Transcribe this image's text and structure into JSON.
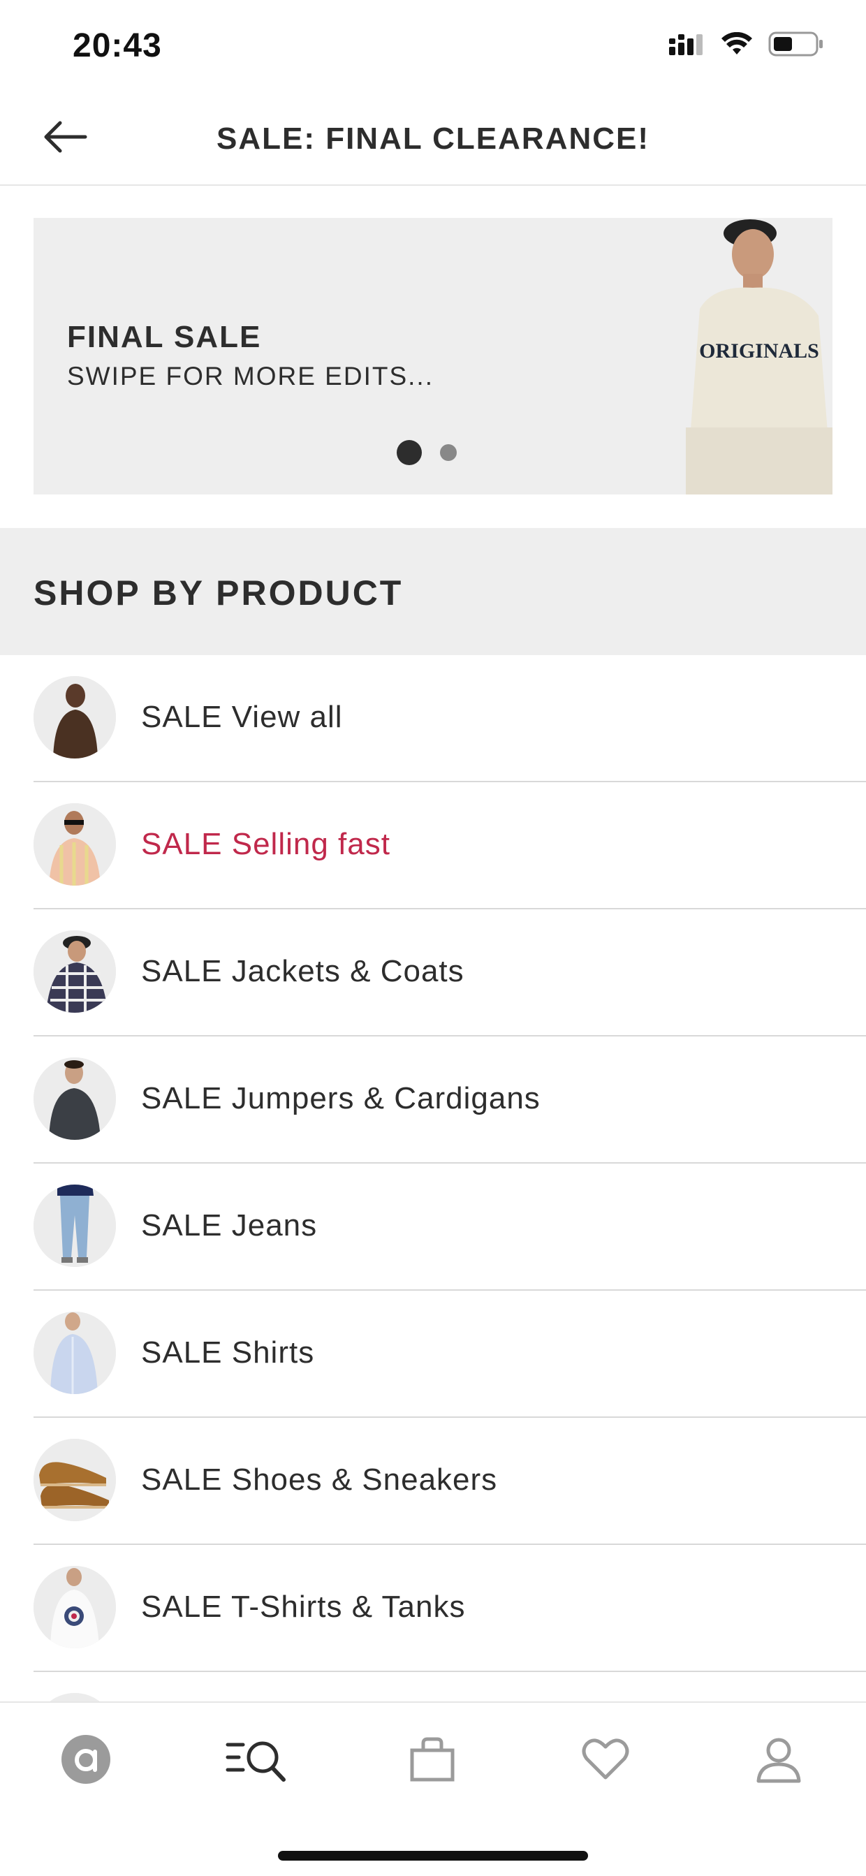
{
  "status_bar": {
    "time": "20:43"
  },
  "header": {
    "title": "SALE: FINAL CLEARANCE!",
    "back_icon": "arrow-left-icon"
  },
  "banner": {
    "title": "FINAL SALE",
    "subtitle": "SWIPE FOR MORE EDITS...",
    "slide_count": 2,
    "active_slide": 1,
    "sweater_text": "ORIGINALS"
  },
  "section": {
    "title": "SHOP BY PRODUCT"
  },
  "list": {
    "items": [
      {
        "label": "SALE View all",
        "highlight": false
      },
      {
        "label": "SALE Selling fast",
        "highlight": true
      },
      {
        "label": "SALE Jackets & Coats",
        "highlight": false
      },
      {
        "label": "SALE Jumpers & Cardigans",
        "highlight": false
      },
      {
        "label": "SALE Jeans",
        "highlight": false
      },
      {
        "label": "SALE Shirts",
        "highlight": false
      },
      {
        "label": "SALE Shoes & Sneakers",
        "highlight": false
      },
      {
        "label": "SALE T-Shirts & Tanks",
        "highlight": false
      }
    ]
  },
  "colors": {
    "accent_red": "#c0284b",
    "text": "#2d2d2d",
    "panel": "#eeeeee"
  },
  "bottom_nav": {
    "items": [
      {
        "icon": "home-logo-icon"
      },
      {
        "icon": "search-categories-icon",
        "active": true
      },
      {
        "icon": "bag-icon"
      },
      {
        "icon": "heart-icon"
      },
      {
        "icon": "account-icon"
      }
    ]
  }
}
